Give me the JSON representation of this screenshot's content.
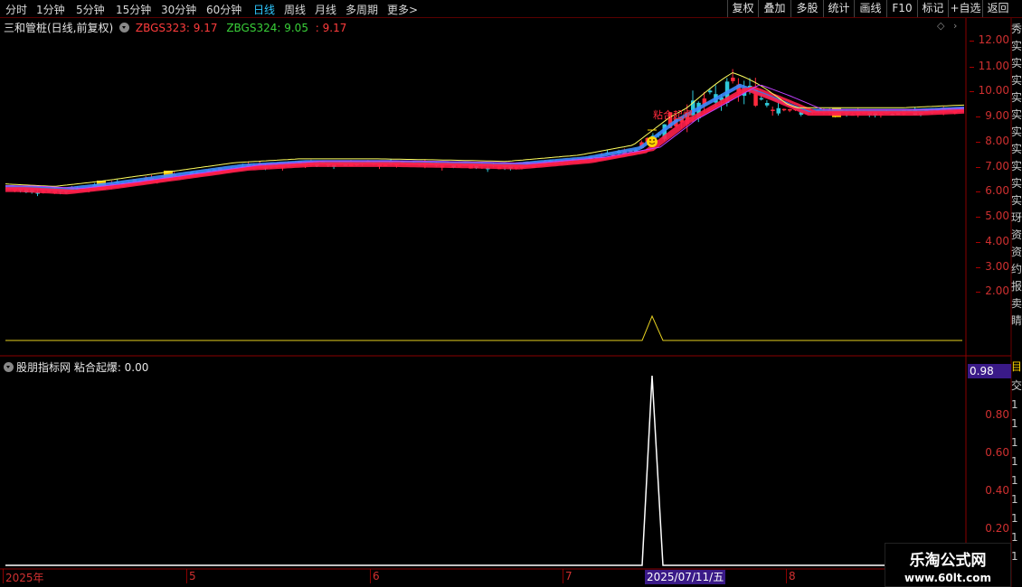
{
  "toolbar": {
    "periods": [
      {
        "label": "分时",
        "active": false
      },
      {
        "label": "1分钟",
        "active": false
      },
      {
        "label": "5分钟",
        "active": false
      },
      {
        "label": "15分钟",
        "active": false
      },
      {
        "label": "30分钟",
        "active": false
      },
      {
        "label": "60分钟",
        "active": false
      },
      {
        "label": "日线",
        "active": true
      },
      {
        "label": "周线",
        "active": false
      },
      {
        "label": "月线",
        "active": false
      },
      {
        "label": "多周期",
        "active": false
      },
      {
        "label": "更多",
        "active": false
      }
    ],
    "more_arrow": ">",
    "buttons": [
      "复权",
      "叠加",
      "多股",
      "统计",
      "画线",
      "F10",
      "标记",
      "+自选",
      "返回"
    ]
  },
  "main_chart": {
    "title": "三和管桩(日线,前复权)",
    "indicator_a": "ZBGS323: 9.17",
    "indicator_b": "ZBGS324: 9.05",
    "indicator_b_extra": ": 9.17",
    "annotation": "粘合起爆",
    "price_ticks": [
      "12.00",
      "11.00",
      "10.00",
      "9.00",
      "8.00",
      "7.00",
      "6.00",
      "5.00",
      "4.00",
      "3.00",
      "2.00"
    ]
  },
  "sub_chart": {
    "header": "股朋指标网 粘合起爆: 0.00",
    "current_value": "0.98",
    "ticks": [
      "0.80",
      "0.60",
      "0.40",
      "0.20"
    ]
  },
  "date_axis": {
    "labels": [
      "2025年",
      "5",
      "6",
      "7",
      "8"
    ],
    "cursor": "2025/07/11/五"
  },
  "watermark": {
    "title": "乐淘公式网",
    "url": "www.60lt.com"
  },
  "side_strip": {
    "chars": [
      "秀",
      "实",
      "实",
      "实",
      "实",
      "实",
      "实",
      "实",
      "实",
      "实",
      "实",
      "玡",
      "资",
      "资",
      "约",
      "报",
      "卖",
      "睛"
    ],
    "sub_chars": [
      "目",
      "交",
      "1",
      "1",
      "1",
      "1",
      "1",
      "1",
      "1",
      "1",
      "1"
    ]
  },
  "colors": {
    "up": "#ff2a3c",
    "down": "#2ec8d8",
    "ma_red": "#ff1f4a",
    "ma_blue": "#3d8bff",
    "ma_yellow": "#ffff60",
    "ma_purple": "#c040ff",
    "axis_red": "#d03030",
    "signal_white": "#ffffff"
  }
}
